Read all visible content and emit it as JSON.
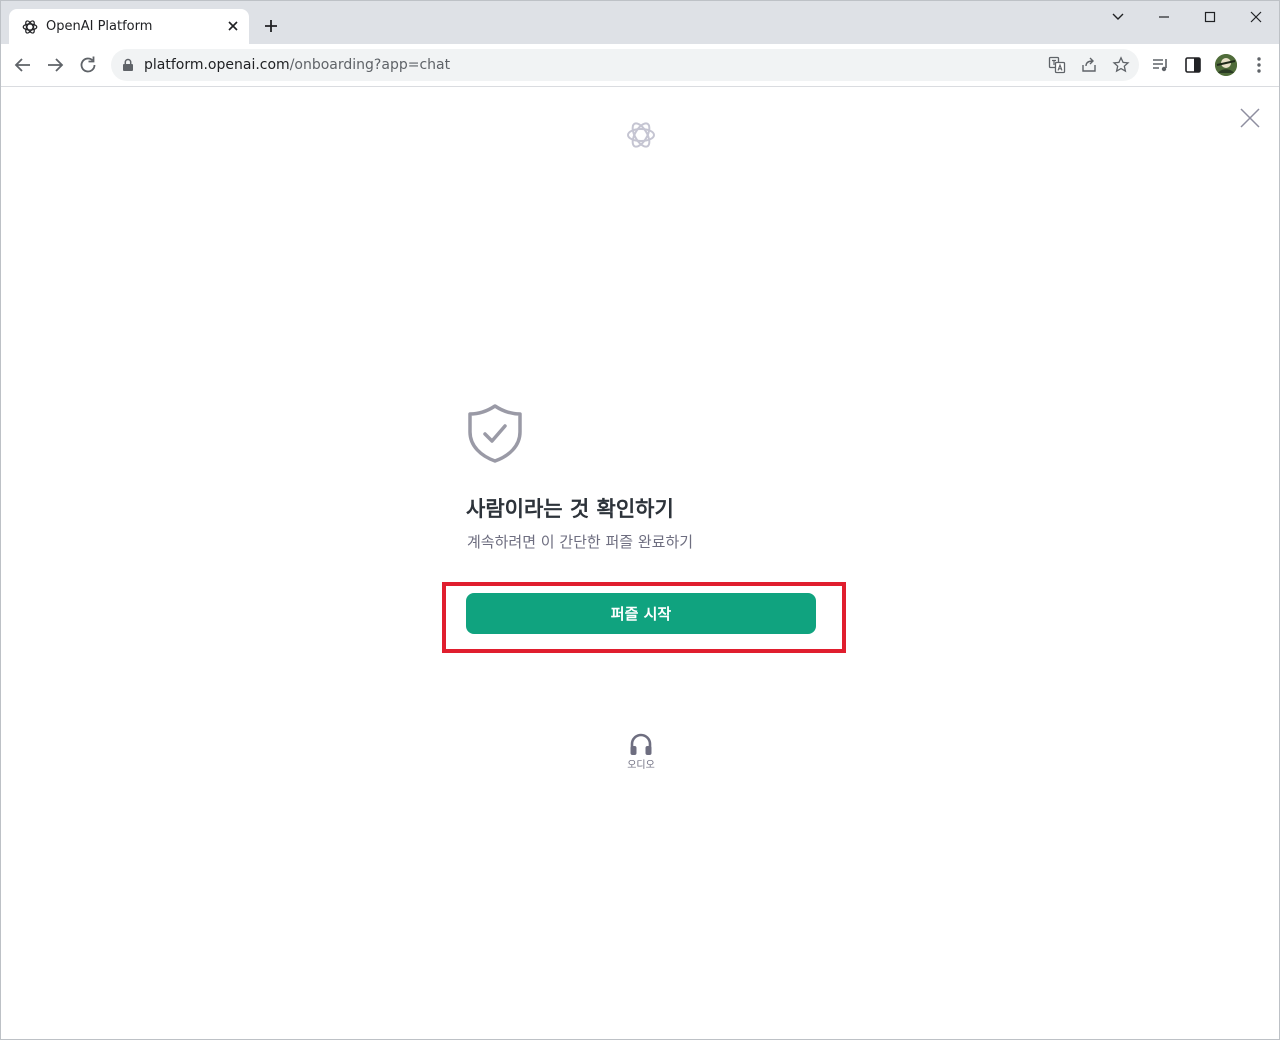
{
  "browser": {
    "tab": {
      "title": "OpenAI Platform"
    },
    "address_bar": {
      "host": "platform.openai.com",
      "path": "/onboarding?app=chat"
    }
  },
  "verification": {
    "title": "사람이라는 것 확인하기",
    "subtitle": "계속하려면 이 간단한 퍼즐 완료하기",
    "start_button_label": "퍼즐 시작",
    "audio_label": "오디오"
  },
  "colors": {
    "accent": "#10a37f",
    "highlight_border": "#e01e2e",
    "title_text": "#2d333a",
    "muted_text": "#6e6e80",
    "tab_strip": "#dee1e6"
  },
  "icons": [
    "openai-logo-icon",
    "close-icon",
    "plus-icon",
    "minimize-icon",
    "maximize-icon",
    "back-arrow-icon",
    "forward-arrow-icon",
    "reload-icon",
    "lock-icon",
    "translate-icon",
    "share-icon",
    "star-icon",
    "media-control-icon",
    "side-panel-icon",
    "kebab-menu-icon",
    "shield-check-icon",
    "headphones-icon"
  ]
}
